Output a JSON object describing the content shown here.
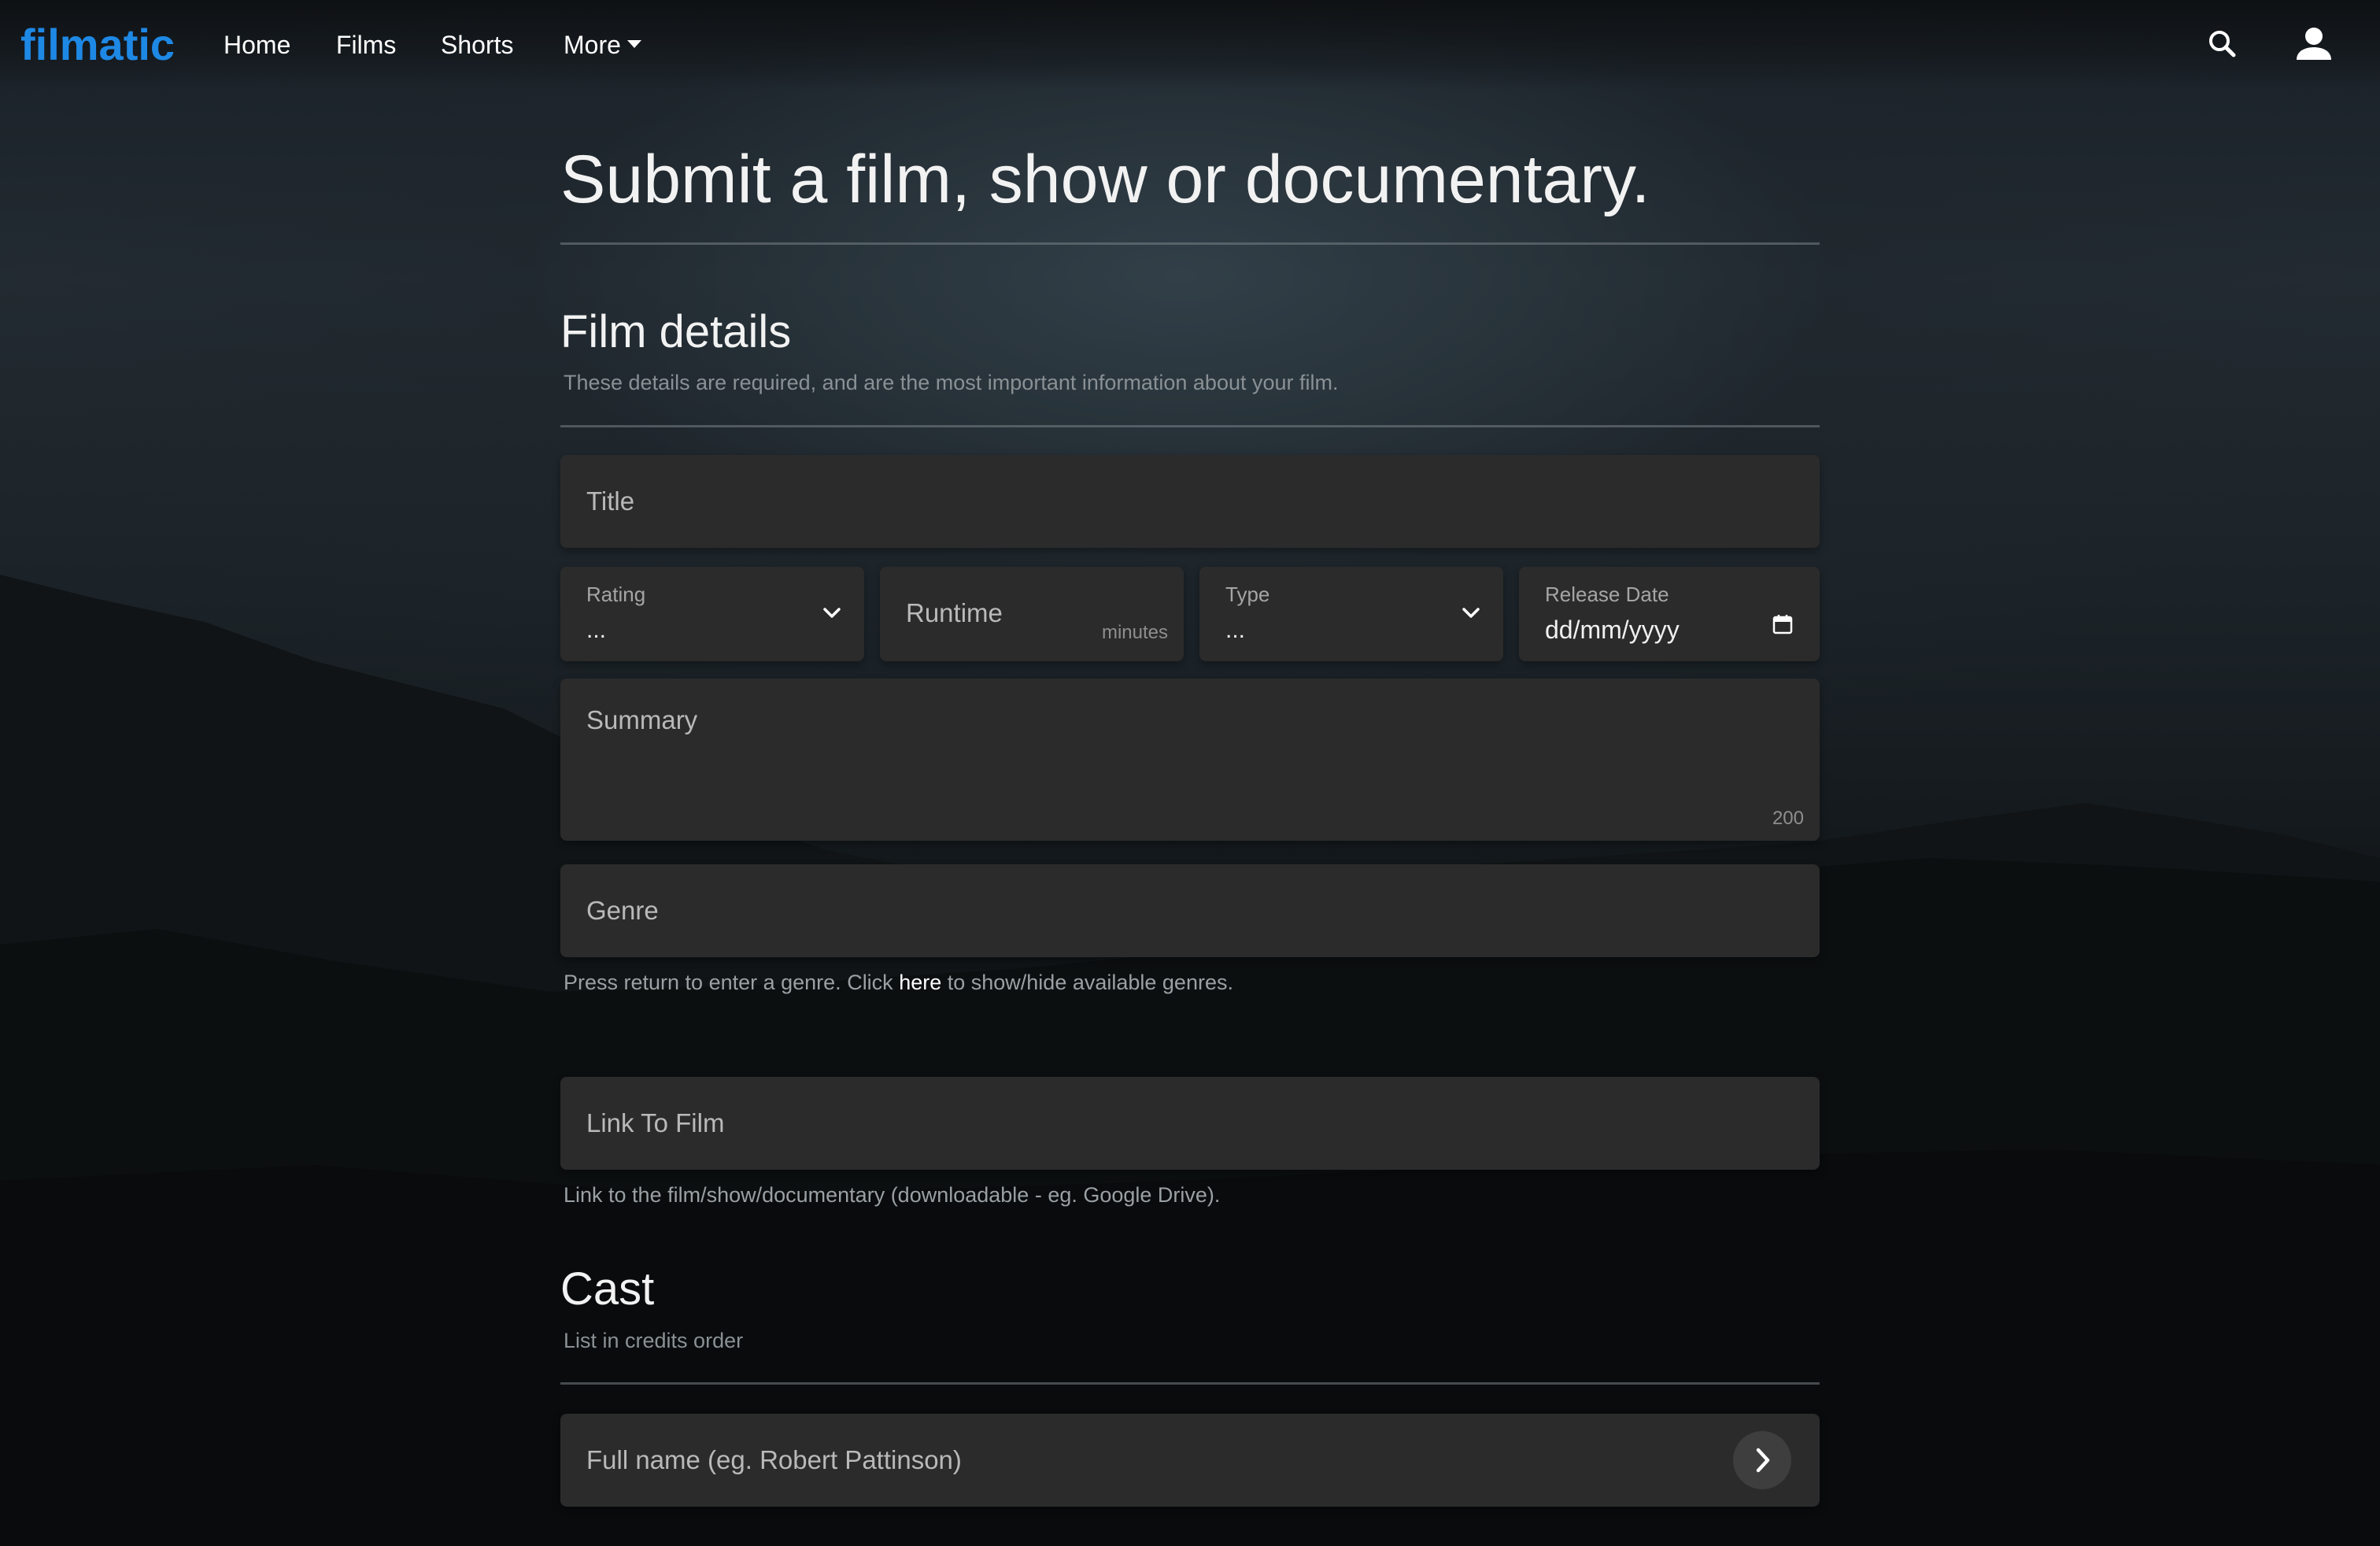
{
  "navbar": {
    "brand": "filmatic",
    "links": {
      "home": "Home",
      "films": "Films",
      "shorts": "Shorts",
      "more": "More"
    },
    "icons": [
      "search-icon",
      "user-icon",
      "caret-down-icon"
    ]
  },
  "page": {
    "title": "Submit a film, show or documentary."
  },
  "film_details": {
    "heading": "Film details",
    "subtitle": "These details are required, and are the most important information about your film.",
    "title_field": {
      "label": "Title"
    },
    "rating": {
      "label": "Rating",
      "value": "..."
    },
    "runtime": {
      "label": "Runtime",
      "suffix": "minutes"
    },
    "type": {
      "label": "Type",
      "value": "..."
    },
    "release_date": {
      "label": "Release Date",
      "value": "dd/mm/yyyy"
    },
    "summary": {
      "label": "Summary",
      "counter": "200"
    },
    "genre": {
      "label": "Genre",
      "hint_before": "Press return to enter a genre. Click ",
      "hint_link": "here",
      "hint_after": " to show/hide available genres."
    },
    "link_to_film": {
      "label": "Link To Film",
      "hint": "Link to the film/show/documentary (downloadable - eg. Google Drive)."
    }
  },
  "cast": {
    "heading": "Cast",
    "subtitle": "List in credits order",
    "name_field": {
      "placeholder": "Full name (eg. Robert Pattinson)"
    }
  },
  "colors": {
    "brand": "#1e88e5",
    "field_bg": "#2b2b2b",
    "background": "#1b2227"
  }
}
